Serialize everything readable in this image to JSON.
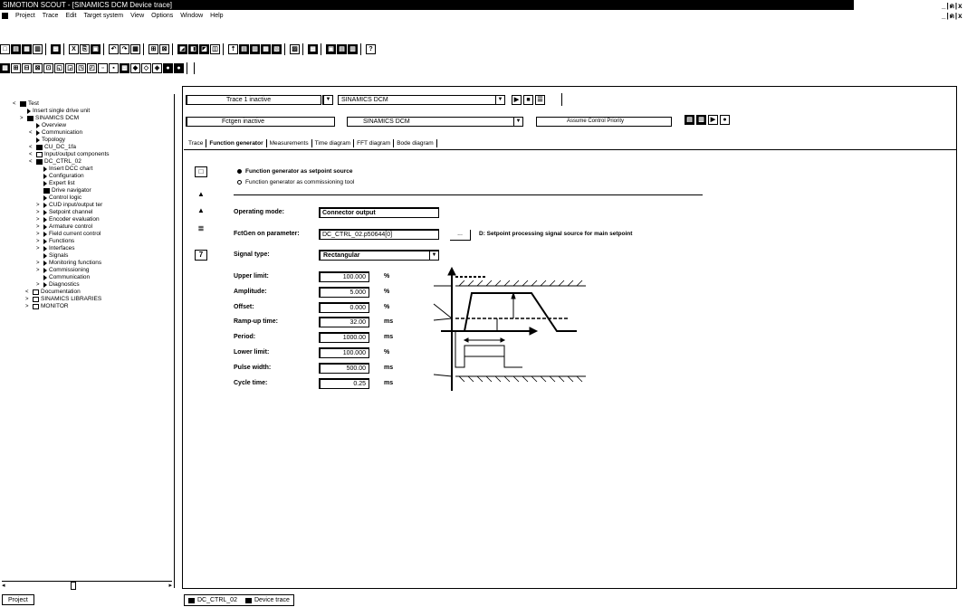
{
  "window": {
    "title": "SIMOTION SCOUT - [SINAMICS DCM Device trace]",
    "controls": "_|ด|x",
    "inner_controls": "_|ด|x"
  },
  "menu": [
    "Project",
    "Trace",
    "Edit",
    "Target system",
    "View",
    "Options",
    "Window",
    "Help"
  ],
  "tree": {
    "items": [
      {
        "exp": "<",
        "icon": "drive",
        "label": "Test"
      },
      {
        "exp": "",
        "icon": "arrow",
        "label": "Insert single drive unit"
      },
      {
        "exp": ">",
        "icon": "drive",
        "label": "SINAMICS DCM"
      },
      {
        "exp": "",
        "icon": "arrow",
        "label": "Overview"
      },
      {
        "exp": "<",
        "icon": "arrow",
        "label": "Communication"
      },
      {
        "exp": "",
        "icon": "arrow",
        "label": "Topology"
      },
      {
        "exp": "<",
        "icon": "drive",
        "label": "CU_DC_1fa"
      },
      {
        "exp": "<",
        "icon": "folder",
        "label": "Input/output components"
      },
      {
        "exp": "<",
        "icon": "drive",
        "label": "DC_CTRL_02"
      },
      {
        "exp": "",
        "icon": "arrow",
        "label": "Insert DCC chart"
      },
      {
        "exp": "",
        "icon": "arrow",
        "label": "Configuration"
      },
      {
        "exp": "",
        "icon": "arrow",
        "label": "Expert list"
      },
      {
        "exp": "",
        "icon": "drive",
        "label": "Drive navigator"
      },
      {
        "exp": "",
        "icon": "arrow",
        "label": "Control logic"
      },
      {
        "exp": ">",
        "icon": "arrow",
        "label": "CUD input/output ter"
      },
      {
        "exp": ">",
        "icon": "arrow",
        "label": "Setpoint channel"
      },
      {
        "exp": ">",
        "icon": "arrow",
        "label": "Encoder evaluation"
      },
      {
        "exp": ">",
        "icon": "arrow",
        "label": "Armature control"
      },
      {
        "exp": ">",
        "icon": "arrow",
        "label": "Field current control"
      },
      {
        "exp": ">",
        "icon": "arrow",
        "label": "Functions"
      },
      {
        "exp": ">",
        "icon": "arrow",
        "label": "Interfaces"
      },
      {
        "exp": "",
        "icon": "arrow",
        "label": "Signals"
      },
      {
        "exp": ">",
        "icon": "arrow",
        "label": "Monitoring functions"
      },
      {
        "exp": ">",
        "icon": "arrow",
        "label": "Commissioning"
      },
      {
        "exp": "",
        "icon": "arrow",
        "label": "Communication"
      },
      {
        "exp": ">",
        "icon": "arrow",
        "label": "Diagnostics"
      },
      {
        "exp": "<",
        "icon": "folder",
        "label": "Documentation"
      },
      {
        "exp": ">",
        "icon": "folder",
        "label": "SINAMICS LIBRARIES"
      },
      {
        "exp": ">",
        "icon": "folder",
        "label": "MONITOR"
      }
    ],
    "bottom_tab": "Project"
  },
  "trace_bar": {
    "trace_select": "Trace 1 inactive",
    "device_select": "SINAMICS DCM",
    "fgen_select": "Fctgen inactive",
    "fgen_device": "SINAMICS DCM",
    "control_priority": "Assume Control Priority"
  },
  "tabs": [
    "Trace",
    "Function generator",
    "Measurements",
    "Time diagram",
    "FFT diagram",
    "Bode diagram"
  ],
  "active_tab": "Function generator",
  "source": {
    "option1": "Function generator as setpoint source",
    "option2": "Function generator as commissioning tool",
    "selected": 0
  },
  "fields": {
    "operating_mode_label": "Operating mode:",
    "operating_mode_value": "Connector output",
    "fctgen_param_label": "FctGen on parameter:",
    "fctgen_param_value": "DC_CTRL_02.p50644[0]",
    "browse_label": "...",
    "fctgen_param_desc": "D: Setpoint processing signal source for main setpoint",
    "signal_type_label": "Signal type:",
    "signal_type_value": "Rectangular",
    "params": [
      {
        "label": "Upper limit:",
        "value": "100.000",
        "unit": "%"
      },
      {
        "label": "Amplitude:",
        "value": "5.000",
        "unit": "%"
      },
      {
        "label": "Offset:",
        "value": "0.000",
        "unit": "%"
      },
      {
        "label": "Ramp-up time:",
        "value": "32.00",
        "unit": "ms"
      },
      {
        "label": "Period:",
        "value": "1000.00",
        "unit": "ms"
      },
      {
        "label": "Lower limit:",
        "value": "100.000",
        "unit": "%"
      },
      {
        "label": "Pulse width:",
        "value": "500.00",
        "unit": "ms"
      },
      {
        "label": "Cycle time:",
        "value": "0.25",
        "unit": "ms"
      }
    ]
  },
  "side_buttons": [
    "□",
    "▲",
    "▲",
    "≣",
    "7"
  ],
  "status_tabs": [
    "DC_CTRL_02",
    "Device trace"
  ]
}
